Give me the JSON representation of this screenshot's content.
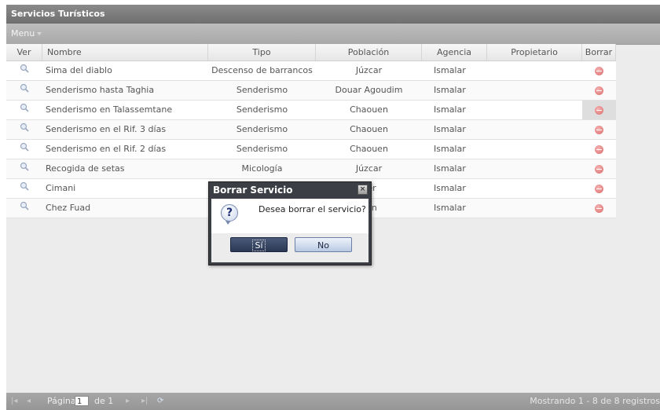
{
  "window": {
    "title": "Servicios Turísticos"
  },
  "menu": {
    "label": "Menu"
  },
  "grid": {
    "columns": [
      "Ver",
      "Nombre",
      "Tipo",
      "Población",
      "Agencia",
      "Propietario",
      "Borrar"
    ],
    "rows": [
      {
        "nombre": "Sima del diablo",
        "tipo": "Descenso de barrancos",
        "poblacion": "Júzcar",
        "agencia": "Ismalar",
        "propietario": ""
      },
      {
        "nombre": "Senderismo hasta Taghia",
        "tipo": "Senderismo",
        "poblacion": "Douar Agoudim",
        "agencia": "Ismalar",
        "propietario": ""
      },
      {
        "nombre": "Senderismo en Talassemtane",
        "tipo": "Senderismo",
        "poblacion": "Chaouen",
        "agencia": "Ismalar",
        "propietario": ""
      },
      {
        "nombre": "Senderismo en el Rif. 3 días",
        "tipo": "Senderismo",
        "poblacion": "Chaouen",
        "agencia": "Ismalar",
        "propietario": ""
      },
      {
        "nombre": "Senderismo en el Rif. 2 días",
        "tipo": "Senderismo",
        "poblacion": "Chaouen",
        "agencia": "Ismalar",
        "propietario": ""
      },
      {
        "nombre": "Recogida de setas",
        "tipo": "Micología",
        "poblacion": "Júzcar",
        "agencia": "Ismalar",
        "propietario": ""
      },
      {
        "nombre": "Cimani",
        "tipo": "",
        "poblacion": "ger",
        "agencia": "Ismalar",
        "propietario": ""
      },
      {
        "nombre": "Chez Fuad",
        "tipo": "",
        "poblacion": "uen",
        "agencia": "Ismalar",
        "propietario": ""
      }
    ]
  },
  "dialog": {
    "title": "Borrar Servicio",
    "message": "Desea borrar el servicio?",
    "yes_label": "Sí",
    "no_label": "No"
  },
  "pager": {
    "page_label": "Página",
    "page_value": "1",
    "of_label": "de 1",
    "status": "Mostrando 1 - 8 de 8 registros"
  }
}
